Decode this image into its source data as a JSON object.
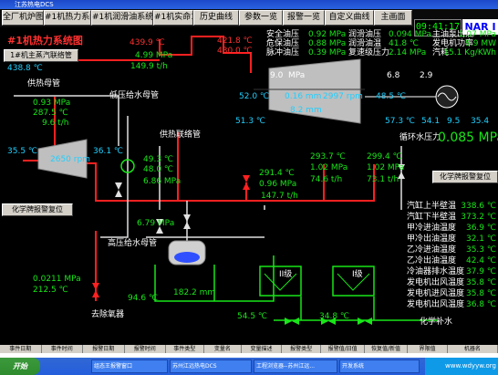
{
  "window": {
    "title": "江苏热电DCS"
  },
  "nav": {
    "buttons": [
      "全厂机炉图",
      "#1机热力系统图",
      "#1机润滑油系统图",
      "#1机实命1",
      "历史曲线",
      "参数一览",
      "报警一览",
      "自定义曲线",
      "主画面"
    ],
    "clock": "09:41:17",
    "brand": "NAR I"
  },
  "diagram": {
    "title": "#1机热力系统图",
    "header_button": "1#机主蒸汽联络管",
    "header_value": "438.8 ℃",
    "main_steam": {
      "temp": "439.9 ℃",
      "pressure": "4.99 MPa",
      "flow": "149.9 t/h"
    },
    "inlet": {
      "temp": "421.8 ℃",
      "temp2": "430.0 ℃"
    },
    "oil_labels": [
      "安全油压",
      "危保油压",
      "脉冲油压"
    ],
    "oil_values": [
      "0.92 MPa",
      "0.88 MPa",
      "0.39 MPa"
    ],
    "lube_labels": [
      "润滑油压",
      "润滑油温",
      "复速级压力"
    ],
    "lube_values": [
      "0.094 MPa",
      "41.8 ℃",
      "2.14 MPa"
    ],
    "gen_labels": [
      "主油泵出油",
      "发电机功率",
      "汽耗"
    ],
    "gen_values": [
      "1.07 MPa",
      "9.9 MW",
      "15.1 Kg/KWh"
    ],
    "turbine": {
      "p_in": "9.0",
      "p_in_unit": "MPa",
      "temp_left_top": "52.0 ℃",
      "temp_left_bottom": "51.3 ℃",
      "pressure_mid": "0.16 mm",
      "speed": "2997 rpm",
      "ext": "8.2 mm",
      "temp_right": "57.3 ℃",
      "gen_a": "6.8",
      "gen_b": "2.9",
      "gen_c": "48.5 ℃",
      "gen_d": "54.1",
      "gen_e": "9.5",
      "gen_f": "35.4"
    },
    "heat_supply": {
      "label": "供热母管",
      "pressure": "0.93 MPa",
      "temp": "287.5 ℃",
      "flow": "9.6 t/h"
    },
    "small_turbine": {
      "temp_in": "35.5 ℃",
      "speed": "2650 rpm",
      "temp_out": "36.1 ℃"
    },
    "lp_feed": {
      "label": "低压给水母管",
      "a": "49.3 ℃",
      "b": "48.0 ℃",
      "c": "6.86 MPa"
    },
    "heat_link": {
      "label": "供热联络管"
    },
    "hp_feed": {
      "label": "高压给水母管",
      "a": "6.79 MPa"
    },
    "reheat": {
      "a": "291.4 ℃",
      "b": "0.96 MPa",
      "c": "147.7 t/h",
      "d": "293.7 ℃",
      "e": "1.02 MPa",
      "f": "74.6 t/h",
      "g": "299.4 ℃",
      "h": "1.02 MPa",
      "i": "73.1 t/h"
    },
    "circ_water": {
      "label": "循环水压力",
      "value": "0.085 MPa"
    },
    "alarm_reset": "化学牌报警复位",
    "deaerator": {
      "label": "去除氧器",
      "pressure": "0.0211 MPa",
      "temp": "212.5 ℃",
      "level": "182.2 mm",
      "flow": "94.6 ℃"
    },
    "heaters": {
      "h2": "II级",
      "h1": "I级"
    },
    "water_a": "54.5 ℃",
    "water_b": "34.8 ℃",
    "chem_water": "化学补水",
    "right_labels": [
      "汽缸上半壁温",
      "汽缸下半壁温",
      "甲冷进油温度",
      "甲冷出油温度",
      "乙冷进油温度",
      "乙冷出油温度",
      "冷油器排水温度",
      "发电机出风温度",
      "发电机进风温度",
      "发电机出风温度"
    ],
    "right_values": [
      "338.6 ℃",
      "373.2 ℃",
      "36.9 ℃",
      "32.1 ℃",
      "35.3 ℃",
      "42.4 ℃",
      "37.9 ℃",
      "35.8 ℃",
      "35.8 ℃",
      "36.8 ℃"
    ]
  },
  "alarm_table": {
    "headers": [
      "事件日期",
      "事件时间",
      "报警日期",
      "报警时间",
      "事件类型",
      "变量名",
      "变量描述",
      "报警类型",
      "报警值/旧值",
      "恢复值/新值",
      "界限值",
      "机器名"
    ]
  },
  "taskbar": {
    "start": "开始",
    "tasks": [
      "组态王报警窗口",
      "苏州江远热电DCS",
      "工程浏览器--苏州江远...",
      "开发系统"
    ],
    "tray": "www.wdyyw.org"
  }
}
